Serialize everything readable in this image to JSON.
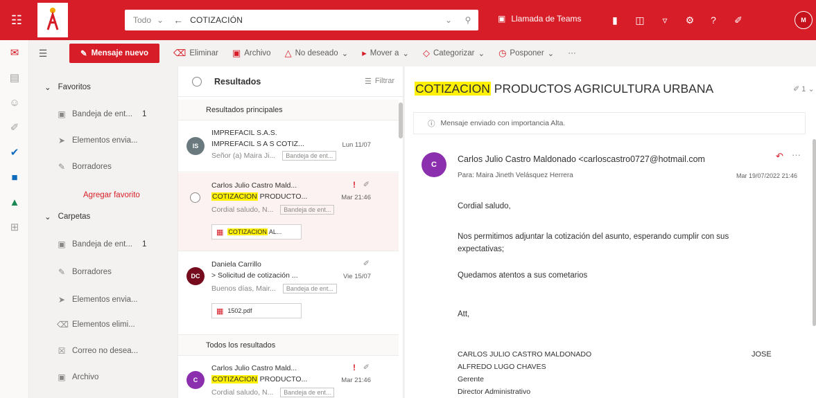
{
  "topbar": {
    "search_scope": "Todo",
    "search_query": "COTIZACIÓN",
    "teams_label": "Llamada de Teams",
    "user_initials": "M"
  },
  "commands": {
    "new_message": "Mensaje nuevo",
    "delete": "Eliminar",
    "archive": "Archivo",
    "junk": "No deseado",
    "move": "Mover a",
    "categorize": "Categorizar",
    "snooze": "Posponer",
    "more": "···"
  },
  "folders": {
    "favorites_header": "Favoritos",
    "favorites": [
      {
        "label": "Bandeja de ent...",
        "count": "1"
      },
      {
        "label": "Elementos envia..."
      },
      {
        "label": "Borradores"
      }
    ],
    "add_favorite": "Agregar favorito",
    "folders_header": "Carpetas",
    "folders": [
      {
        "label": "Bandeja de ent...",
        "count": "1"
      },
      {
        "label": "Borradores"
      },
      {
        "label": "Elementos envia..."
      },
      {
        "label": "Elementos elimi..."
      },
      {
        "label": "Correo no desea..."
      },
      {
        "label": "Archivo"
      }
    ]
  },
  "list": {
    "title": "Resultados",
    "filter": "Filtrar",
    "section_top": "Resultados principales",
    "section_all": "Todos los resultados",
    "items": [
      {
        "initials": "IS",
        "color": "#69797e",
        "sender": "IMPREFACIL S.A.S.",
        "subject": "IMPREFACIL S A S COTIZ...",
        "date": "Lun 11/07",
        "preview": "Señor (a) Maira Ji...",
        "folder": "Bandeja de ent..."
      },
      {
        "sender": "Carlos Julio Castro Mald...",
        "subject_hl": "COTIZACION",
        "subject_rest": " PRODUCTO...",
        "date": "Mar 21:46",
        "preview": "Cordial saludo, N...",
        "folder": "Bandeja de ent...",
        "attachment_hl": "COTIZACION",
        "attachment_rest": " AL..."
      },
      {
        "initials": "DC",
        "color": "#750b1c",
        "sender": "Daniela Carrillo",
        "subject": "> Solicitud de cotización ...",
        "date": "Vie 15/07",
        "preview": "Buenos días, Mair...",
        "folder": "Bandeja de ent...",
        "attachment": "1502.pdf"
      },
      {
        "initials": "C",
        "color": "#8b2fae",
        "sender": "Carlos Julio Castro Mald...",
        "subject_hl": "COTIZACION",
        "subject_rest": " PRODUCTO...",
        "date": "Mar 21:46",
        "preview": "Cordial saludo, N...",
        "folder": "Bandeja de ent..."
      }
    ]
  },
  "reader": {
    "subject_hl": "COTIZACION",
    "subject_rest": " PRODUCTOS AGRICULTURA URBANA",
    "count": "1",
    "importance": "Mensaje enviado con importancia Alta.",
    "sender_initial": "C",
    "from": "Carlos Julio Castro Maldonado <carloscastro0727@hotmail.com",
    "to": "Para:  Maira Jineth Velásquez Herrera",
    "date": "Mar 19/07/2022 21:46",
    "body": [
      "Cordial saludo,",
      "Nos permitimos adjuntar la cotización del asunto, esperando cumplir con sus",
      "expectativas;",
      "Quedamos atentos a sus cometarios",
      "Att,",
      "CARLOS JULIO CASTRO MALDONADO",
      "ALFREDO LUGO CHAVES",
      "Gerente",
      "Director Administrativo"
    ],
    "sig_right": "JOSE"
  }
}
